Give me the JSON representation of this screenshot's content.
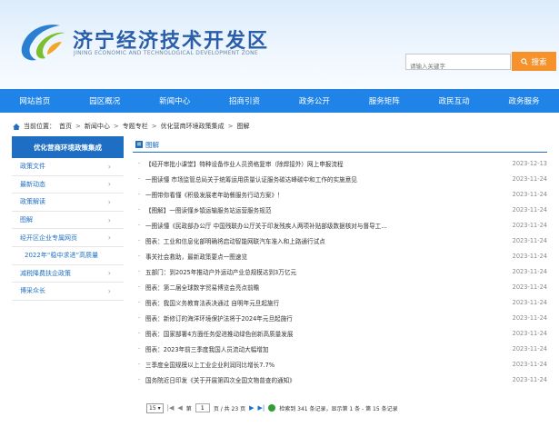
{
  "header": {
    "title": "济宁经济技术开发区",
    "subtitle": "JINING ECONOMIC AND TECHNOLOGICAL DEVELOPMENT ZONE",
    "search_placeholder": "请输入关键字",
    "search_button": "搜索"
  },
  "nav": {
    "items": [
      "网站首页",
      "园区概况",
      "新闻中心",
      "招商引资",
      "政务公开",
      "服务矩阵",
      "政民互动",
      "政务服务"
    ]
  },
  "breadcrumb": {
    "label": "当前位置：",
    "items": [
      "首页",
      "新闻中心",
      "专题专栏",
      "优化营商环境政策集成",
      "图解"
    ]
  },
  "sidebar": {
    "title": "优化营商环境政策集成",
    "items": [
      {
        "label": "政策文件"
      },
      {
        "label": "最新动态"
      },
      {
        "label": "政策解读"
      },
      {
        "label": "图解"
      },
      {
        "label": "经开区企业专属网页"
      },
      {
        "label": "2022年“稳中求进”高质量"
      },
      {
        "label": "减税降费扶企政策"
      },
      {
        "label": "博采众长"
      }
    ]
  },
  "main": {
    "tab_label": "图解",
    "articles": [
      {
        "title": "【经开审批小课堂】特种设备作业人员资格复审（除焊接外）网上申报流程",
        "date": "2023-12-13"
      },
      {
        "title": "一图读懂 市场监管总局关于统筹运用质量认证服务碳达峰碳中和工作的实施意见",
        "date": "2023-11-24"
      },
      {
        "title": "一图带你看懂《积极发展老年助餐服务行动方案》！",
        "date": "2023-11-24"
      },
      {
        "title": "【图解】一图读懂乡镇运输服务站运营服务规范",
        "date": "2023-11-24"
      },
      {
        "title": "一图读懂《民政部办公厅 中国残联办公厅关于印发残疾人两项补贴部级数据核对与督导工...",
        "date": "2023-11-24"
      },
      {
        "title": "图表：工业和信息化部明确将启动智能网联汽车准入和上路通行试点",
        "date": "2023-11-24"
      },
      {
        "title": "事关社会救助，最新政策要点一图速览",
        "date": "2023-11-24"
      },
      {
        "title": "五部门：到2025年推动户外运动产业总规模达到3万亿元",
        "date": "2023-11-24"
      },
      {
        "title": "图表：第二届全球数字贸易博览会亮点前瞻",
        "date": "2023-11-24"
      },
      {
        "title": "图表：我国义务教育法表决通过 自明年元旦起施行",
        "date": "2023-11-24"
      },
      {
        "title": "图表：新修订的海洋环境保护法将于2024年元旦起施行",
        "date": "2023-11-24"
      },
      {
        "title": "图表：国家部署4方面任务促进推动绿色创新高质量发展",
        "date": "2023-11-24"
      },
      {
        "title": "图表：2023年前三季度我国人员流动大幅增加",
        "date": "2023-11-24"
      },
      {
        "title": "三季度全国规模以上工业企业利润同比增长7.7%",
        "date": "2023-11-24"
      },
      {
        "title": "国务院近日印发《关于开展第四次全国文物普查的通知》",
        "date": "2023-11-24"
      }
    ]
  },
  "pager": {
    "page_size": "15",
    "page_prefix": "第",
    "current_page": "1",
    "page_suffix": "页 / 共 23 页",
    "summary": "检索到 341 条记录，显示第 1 条 - 第 15 条记录"
  },
  "colors": {
    "nav_bg": "#1f83e8",
    "sidebar_header_bg": "#1e6fc3",
    "accent_blue": "#1e6fc3",
    "search_button_bg": "#f6922b",
    "title_blue": "#2a5ea8"
  },
  "icons": {
    "logo": "jining-edz-logo",
    "search": "search-icon",
    "breadcrumb": "home-icon",
    "tab": "article-icon",
    "pager_refresh": "refresh-icon"
  }
}
